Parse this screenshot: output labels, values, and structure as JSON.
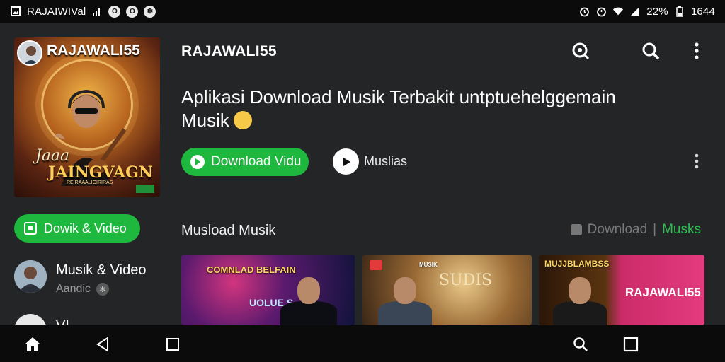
{
  "status_bar": {
    "app_name": "RAJAIWIVal",
    "time": "1644",
    "battery": "22%"
  },
  "cover": {
    "brand": "RAJAWALI55",
    "line1": "Jaaa",
    "line2": "JAINGVAGN",
    "line3": "RE RAAALIGIRIRAS"
  },
  "left": {
    "button_label": "Dowik & Video",
    "list_item_title": "Musik & Video",
    "list_item_subtitle": "Aandic",
    "list_peek": "VI..."
  },
  "header": {
    "title": "RAJAWALI55"
  },
  "hero": {
    "headline_line1": "Aplikasi Download Musik Terbakit  untptuehelggemain",
    "headline_line2": "Musik",
    "download_label": "Download Vidu",
    "play_label": "Muslias"
  },
  "section": {
    "title": "Musload Musik",
    "right_gray": "Download",
    "right_sep": "|",
    "right_green": "Musks"
  },
  "cards": [
    {
      "text": "COMNLAD BELFAIN",
      "text2": "UOLUE S"
    },
    {
      "text": "MUSIK",
      "text2": "SUDIS"
    },
    {
      "text": "MUJJBLAMBSS",
      "text2": "RAJAWALI55"
    }
  ],
  "colors": {
    "accent_green": "#1fb83f",
    "background": "#242527",
    "bars": "#0b0b0c"
  }
}
